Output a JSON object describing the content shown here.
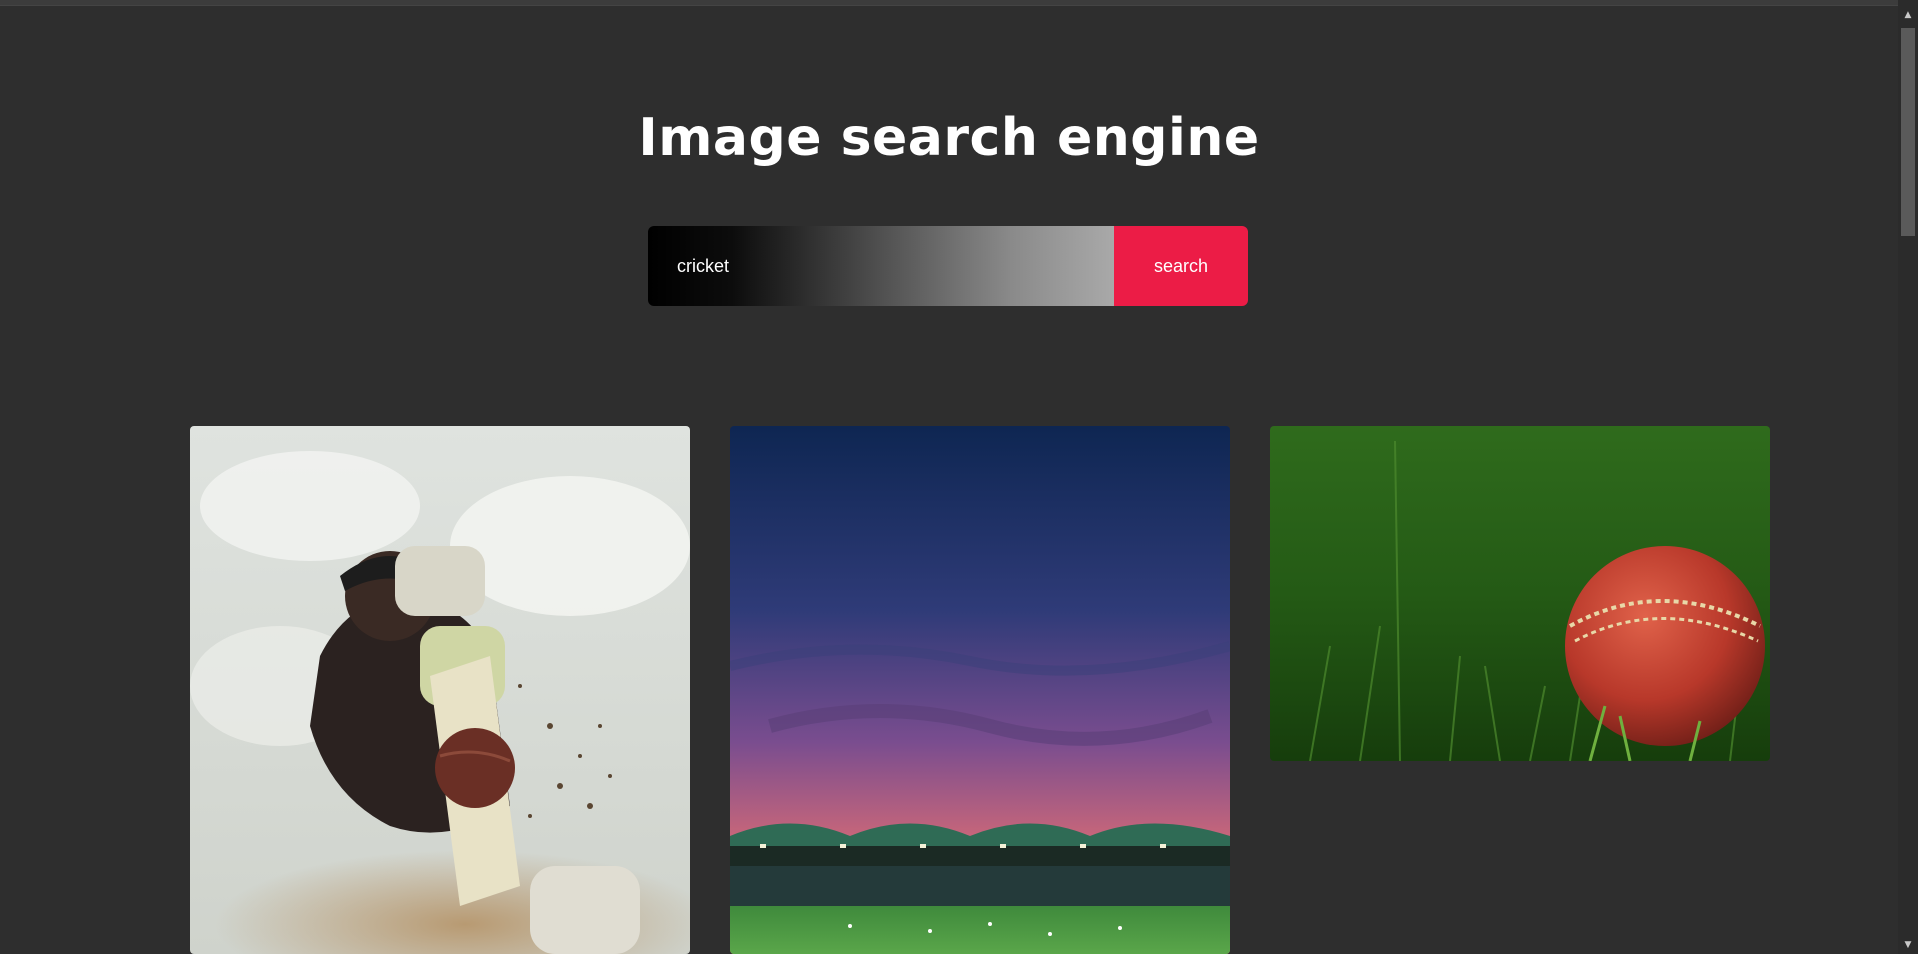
{
  "page": {
    "title": "Image search engine"
  },
  "search": {
    "value": "cricket",
    "button_label": "search"
  },
  "results": [
    {
      "name": "batsman-hitting-ball"
    },
    {
      "name": "cricket-stadium-at-dusk"
    },
    {
      "name": "red-cricket-ball-on-grass"
    }
  ],
  "colors": {
    "background": "#2e2e2e",
    "accent": "#ec1c46",
    "text": "#ffffff"
  },
  "icons": {
    "scroll_up": "▲",
    "scroll_down": "▼"
  }
}
